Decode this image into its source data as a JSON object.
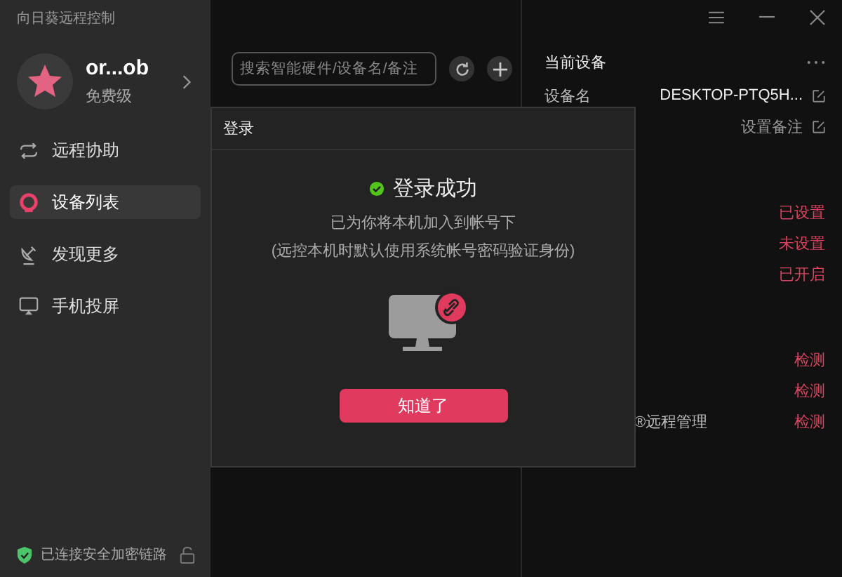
{
  "window": {
    "title": "向日葵远程控制"
  },
  "user": {
    "name": "or...ob",
    "plan": "免费级"
  },
  "nav": [
    {
      "label": "远程协助",
      "kind": "remote",
      "selected": false
    },
    {
      "label": "设备列表",
      "kind": "devices",
      "selected": true
    },
    {
      "label": "发现更多",
      "kind": "discover",
      "selected": false
    },
    {
      "label": "手机投屏",
      "kind": "cast",
      "selected": false
    }
  ],
  "status": {
    "text": "已连接安全加密链路"
  },
  "search": {
    "placeholder": "搜索智能硬件/设备名/备注"
  },
  "device_panel": {
    "title": "当前设备",
    "sections": [
      [
        {
          "label": "设备名",
          "value": "DESKTOP-PTQ5H...",
          "kind": "name",
          "editable": true
        },
        {
          "value": "设置备注",
          "kind": "note",
          "editable": true
        }
      ],
      [
        {
          "value": "已设置",
          "kind": "status"
        },
        {
          "value": "未设置",
          "kind": "status"
        },
        {
          "value": "已开启",
          "kind": "status"
        }
      ],
      [
        {
          "value": "检测",
          "kind": "status"
        },
        {
          "value": "检测",
          "kind": "status"
        },
        {
          "label": "®远程管理",
          "value": "检测",
          "kind": "status"
        }
      ]
    ]
  },
  "dialog": {
    "title": "登录",
    "heading": "登录成功",
    "lines": [
      "已为你将本机加入到帐号下",
      "(远控本机时默认使用系统帐号密码验证身份)"
    ],
    "button": "知道了"
  }
}
